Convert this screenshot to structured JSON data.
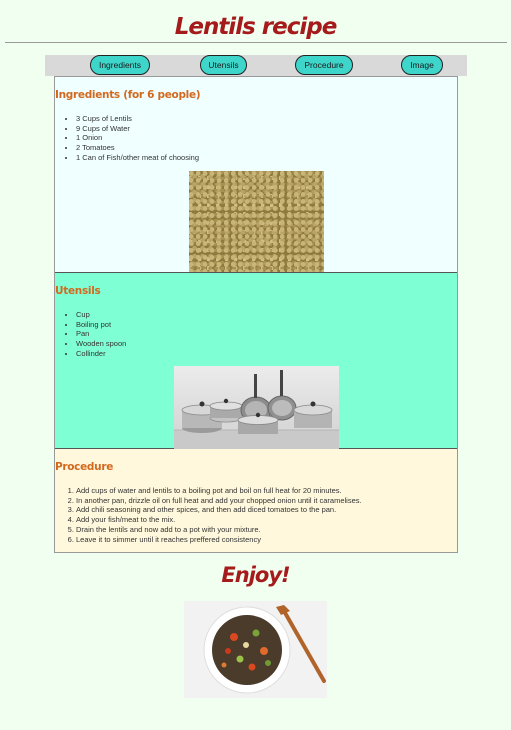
{
  "page": {
    "title": "Lentils recipe",
    "closing": "Enjoy!"
  },
  "nav": {
    "items": [
      {
        "label": "Ingredients"
      },
      {
        "label": "Utensils"
      },
      {
        "label": "Procedure"
      },
      {
        "label": "Image"
      }
    ]
  },
  "ingredients": {
    "heading": "Ingredients (for 6 people)",
    "items": [
      "3 Cups of Lentils",
      "9 Cups of Water",
      "1 Onion",
      "2 Tomatoes",
      "1 Can of Fish/other meat of choosing"
    ]
  },
  "utensils": {
    "heading": "Utensils",
    "items": [
      "Cup",
      "Boiling pot",
      "Pan",
      "Wooden spoon",
      "Collinder"
    ]
  },
  "procedure": {
    "heading": "Procedure",
    "steps": [
      "Add cups of water and lentils to a boiling pot and boil on full heat for 20 minutes.",
      "In another pan, drizzle oil on full heat and add your chopped onion until it caramelises.",
      "Add chili seasoning and other spices, and then add diced tomatoes to the pan.",
      "Add your fish/meat to the mix.",
      "Drain the lentils and now add to a pot with your mixture.",
      "Leave it to simmer until it reaches preffered consistency"
    ]
  },
  "colors": {
    "title": "#a51a1a",
    "section_heading": "#d2691e",
    "nav_button": "#3ed6cb",
    "ingredients_bg": "#f0ffff",
    "utensils_bg": "#7fffd4",
    "procedure_bg": "#fff8dc",
    "page_bg": "#f0fff0"
  },
  "images": {
    "lentils": "lentils-photo",
    "utensils": "pots-and-pans-photo",
    "dish": "lentil-salad-bowl-photo"
  }
}
